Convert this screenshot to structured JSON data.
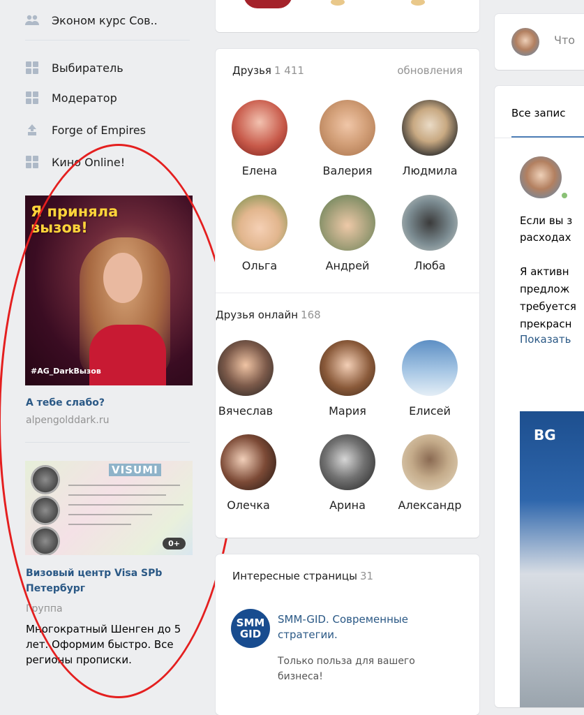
{
  "left_menu": {
    "items": [
      {
        "label": "Эконом курс Сов..",
        "icon": "people-icon"
      },
      {
        "label": "Выбиратель",
        "icon": "app-grid-icon"
      },
      {
        "label": "Модератор",
        "icon": "app-grid-icon"
      },
      {
        "label": "Forge of Empires",
        "icon": "forge-icon"
      },
      {
        "label": "Кино Online!",
        "icon": "app-grid-icon"
      }
    ]
  },
  "ads": [
    {
      "image_text": "Я приняла вызов!",
      "image_tag": "#AG_DarkВызов",
      "title": "А тебе слабо?",
      "domain": "alpengolddark.ru"
    },
    {
      "image_text": "VISUMI",
      "age_badge": "0+",
      "title": "Визовый центр Visa SPb Петербург",
      "subtitle": "Группа",
      "description": "Многократный Шенген до 5 лет. Оформим быстро. Все регионы прописки."
    }
  ],
  "friends_card": {
    "title": "Друзья",
    "count": "1 411",
    "action": "обновления",
    "friends": [
      "Елена",
      "Валерия",
      "Людмила",
      "Ольга",
      "Андрей",
      "Люба"
    ],
    "online_title": "Друзья онлайн",
    "online_count": "168",
    "online_friends": [
      "Вячеслав",
      "Мария",
      "Елисей",
      "Олечка",
      "Арина",
      "Александр"
    ]
  },
  "pages_card": {
    "title": "Интересные страницы",
    "count": "31",
    "page": {
      "logo_line1": "SMM",
      "logo_line2": "GID",
      "title": "SMM-GID. Современные стратегии.",
      "description": "Только польза для вашего бизнеса!"
    }
  },
  "feed": {
    "compose_placeholder": "Что",
    "tab": "Все запис",
    "post_lines": [
      "Если вы з",
      "расходах",
      "Я активн",
      "предлож",
      "требуется",
      "прекрасн"
    ],
    "show_more": "Показать",
    "image_logo": "BG"
  },
  "colors": {
    "background": "#edeef0",
    "link": "#2a5885",
    "muted": "#939393",
    "accent": "#5181b8",
    "highlight_oval": "#e41f1f"
  }
}
